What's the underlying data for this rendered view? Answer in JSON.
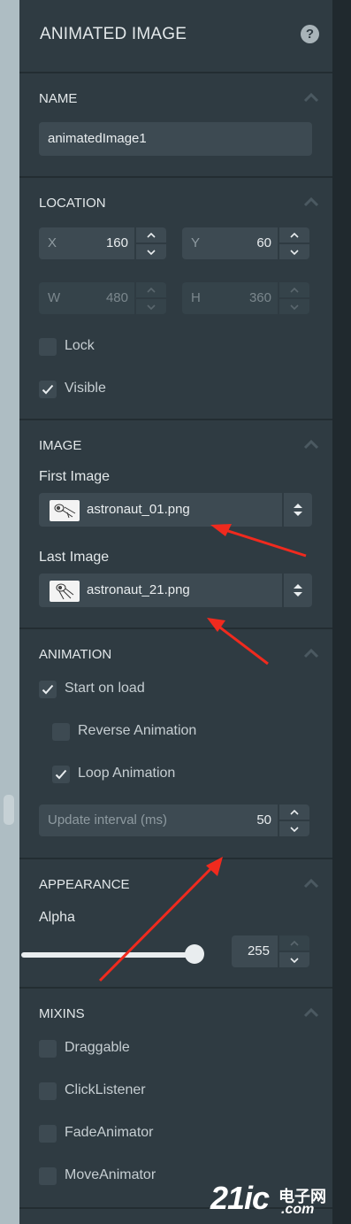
{
  "panel": {
    "title": "ANIMATED IMAGE",
    "help_icon": "question-circle-icon"
  },
  "name_section": {
    "title": "NAME",
    "value": "animatedImage1"
  },
  "location": {
    "title": "LOCATION",
    "x_label": "X",
    "x_value": "160",
    "y_label": "Y",
    "y_value": "60",
    "w_label": "W",
    "w_value": "480",
    "h_label": "H",
    "h_value": "360",
    "lock_label": "Lock",
    "lock_checked": false,
    "visible_label": "Visible",
    "visible_checked": true
  },
  "image": {
    "title": "IMAGE",
    "first_label": "First Image",
    "first_value": "astronaut_01.png",
    "last_label": "Last Image",
    "last_value": "astronaut_21.png"
  },
  "animation": {
    "title": "ANIMATION",
    "start_on_load_label": "Start on load",
    "start_on_load_checked": true,
    "reverse_label": "Reverse Animation",
    "reverse_checked": false,
    "loop_label": "Loop Animation",
    "loop_checked": true,
    "interval_label": "Update interval (ms)",
    "interval_value": "50"
  },
  "appearance": {
    "title": "APPEARANCE",
    "alpha_label": "Alpha",
    "alpha_value": "255",
    "alpha_fraction": 1.0
  },
  "mixins": {
    "title": "MIXINS",
    "items": [
      {
        "label": "Draggable",
        "checked": false
      },
      {
        "label": "ClickListener",
        "checked": false
      },
      {
        "label": "FadeAnimator",
        "checked": false
      },
      {
        "label": "MoveAnimator",
        "checked": false
      }
    ]
  },
  "watermark": {
    "main": "21ic",
    "sub": "电子网",
    "sub2": ".com"
  },
  "colors": {
    "panel_bg": "#2f3b42",
    "field_bg": "#3d4a52",
    "annotation_arrow": "#f02a1e"
  }
}
